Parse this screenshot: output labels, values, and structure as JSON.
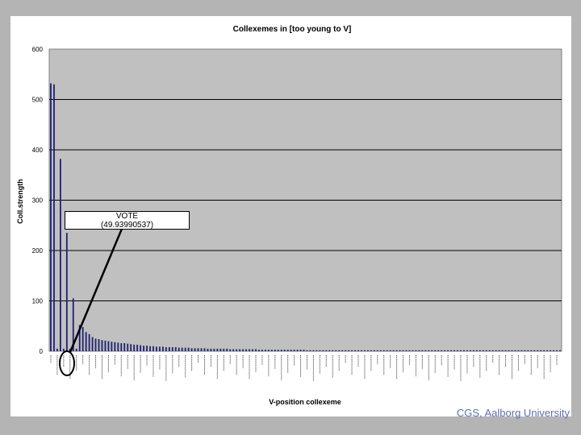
{
  "footer": {
    "text": "CGS, Aalborg University"
  },
  "callout": {
    "label": "VOTE",
    "value": "(49.93990537)"
  },
  "colors": {
    "plot_bg": "#c0c0c0",
    "bar": "#1c1f73",
    "grid": "#000000",
    "footer": "#5b6fb4"
  },
  "chart_data": {
    "type": "bar",
    "title": "Collexemes in [too young to V]",
    "xlabel": "V-position collexeme",
    "ylabel": "Coll.strength",
    "ylim": [
      0,
      600
    ],
    "yticks": [
      0,
      100,
      200,
      300,
      400,
      500,
      600
    ],
    "grid": true,
    "legend": "none",
    "bar_count": 160,
    "values": [
      532,
      530,
      5,
      382,
      5,
      235,
      5,
      105,
      5,
      52,
      48,
      38,
      34,
      28,
      25,
      24,
      22,
      21,
      20,
      19,
      18,
      17,
      16,
      16,
      15,
      14,
      13,
      13,
      12,
      11,
      11,
      10,
      10,
      9,
      9,
      9,
      8,
      8,
      8,
      8,
      7,
      7,
      7,
      7,
      6,
      6,
      6,
      6,
      6,
      5,
      5,
      5,
      5,
      5,
      5,
      5,
      4,
      4,
      4,
      4,
      4,
      4,
      4,
      4,
      4,
      3,
      3,
      3,
      3,
      3,
      3,
      3,
      3,
      3,
      3,
      3,
      3,
      3,
      3,
      3,
      2,
      2,
      2,
      2,
      2,
      2,
      2,
      2,
      2,
      2,
      2,
      2,
      2,
      2,
      2,
      2,
      2,
      2,
      2,
      2,
      2,
      2,
      2,
      2,
      2,
      2,
      2,
      2,
      2,
      2,
      2,
      2,
      2,
      2,
      2,
      2,
      2,
      2,
      2,
      2,
      2,
      2,
      2,
      2,
      2,
      2,
      2,
      2,
      2,
      2,
      2,
      2,
      2,
      2,
      2,
      2,
      2,
      2,
      2,
      2,
      2,
      2,
      2,
      2,
      2,
      2,
      2,
      2,
      2,
      2,
      2,
      2,
      2,
      2,
      2,
      2,
      2,
      2,
      2,
      2
    ],
    "highlight_index": 9
  }
}
